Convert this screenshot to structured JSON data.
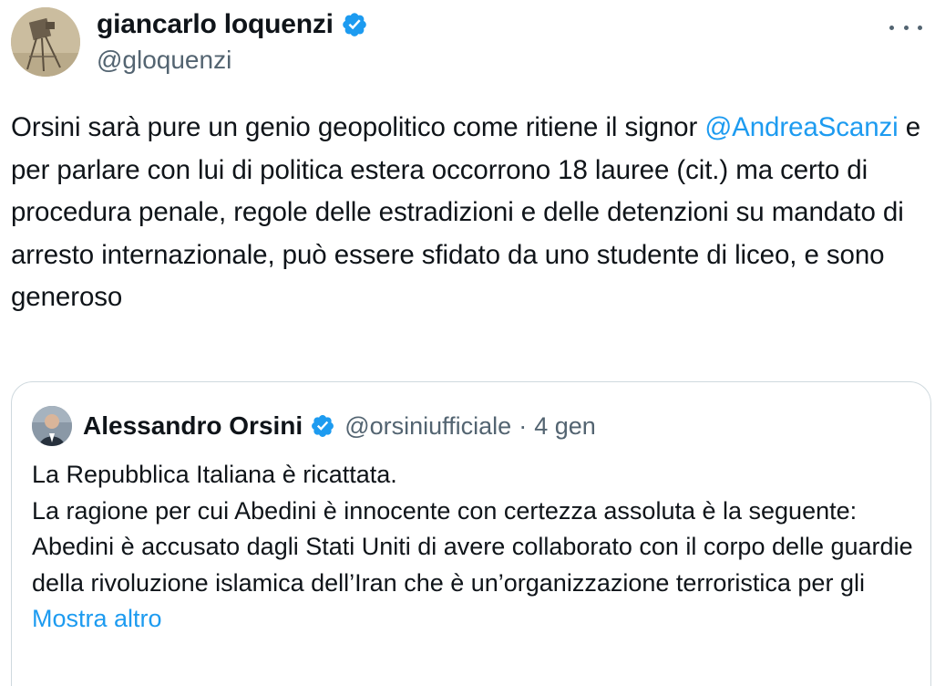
{
  "author": {
    "display_name": "giancarlo loquenzi",
    "handle": "@gloquenzi",
    "avatar_icon": "camera-sculpture-avatar",
    "verified_icon": "verified-badge-icon"
  },
  "tweet": {
    "text_before": "Orsini sarà pure un genio geopolitico come ritiene il signor ",
    "mention": "@AndreaScanzi",
    "text_after": " e per parlare con lui di politica estera occorrono 18 lauree (cit.) ma certo di procedura penale, regole delle estradizioni e delle detenzioni su mandato di arresto internazionale, può essere sfidato da uno studente di liceo, e sono generoso"
  },
  "quoted": {
    "display_name": "Alessandro Orsini",
    "handle": "@orsiniufficiale",
    "separator": "·",
    "date": "4 gen",
    "lines": [
      "La Repubblica Italiana è ricattata.",
      "La ragione per cui Abedini è innocente con certezza assoluta è la seguente: Abedini è accusato dagli Stati Uniti di avere collaborato con il corpo delle guardie della rivoluzione islamica dell’Iran che è un’organizzazione terroristica per gli"
    ],
    "show_more": "Mostra altro"
  },
  "colors": {
    "accent": "#1d9bf0",
    "text": "#0f1419",
    "muted": "#536471",
    "border": "#cfd9de"
  }
}
